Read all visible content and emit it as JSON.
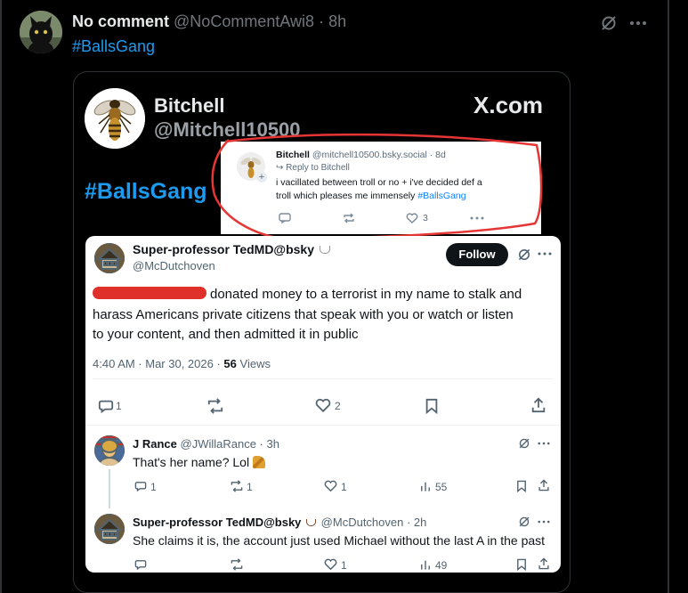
{
  "post": {
    "display_name": "No comment",
    "handle": "@NoCommentAwi8",
    "separator": "·",
    "time": "8h",
    "text": "#BallsGang"
  },
  "embed": {
    "repost_name": "Bitchell",
    "repost_handle": "@Mitchell10500",
    "repost_hashtag": "#BallsGang",
    "brand": "X.com",
    "bsky_card": {
      "name": "Bitchell",
      "handle": "@mitchell10500.bsky.social",
      "time": "· 8d",
      "reply_label": "Reply to Bitchell",
      "text_line1": "i vacillated between troll or no + i've decided def a",
      "text_line2": "troll which pleases me immensely",
      "hashtag": "#BallsGang",
      "like_count": "3"
    },
    "tweet": {
      "name": "Super-professor TedMD@bsky",
      "handle": "@McDutchoven",
      "follow_label": "Follow",
      "text_line1": "donated money to a terrorist in my name to stalk and",
      "text_line2": "harass Americans private citizens that speak with you or watch or listen",
      "text_line3": "to your content, and then admitted it in public",
      "time": "4:40 AM · Mar 30, 2026 ·",
      "views_count": "56",
      "views_label": "Views",
      "reply_count": "1",
      "like_count": "2"
    },
    "replies": [
      {
        "name": "J Rance",
        "handle": "@JWillaRance · 3h",
        "text": "That's her name? Lol",
        "reply_count": "1",
        "repost_count": "1",
        "like_count": "1",
        "views_count": "55"
      },
      {
        "name": "Super-professor TedMD@bsky",
        "handle": "@McDutchoven · 2h",
        "text": "She claims it is, the account just used Michael without the last A in the past",
        "reply_count": "",
        "repost_count": "",
        "like_count": "1",
        "views_count": "49"
      }
    ]
  },
  "colors": {
    "accent": "#1d9bf0",
    "redact": "#e0302a",
    "annotation": "#e63535"
  }
}
